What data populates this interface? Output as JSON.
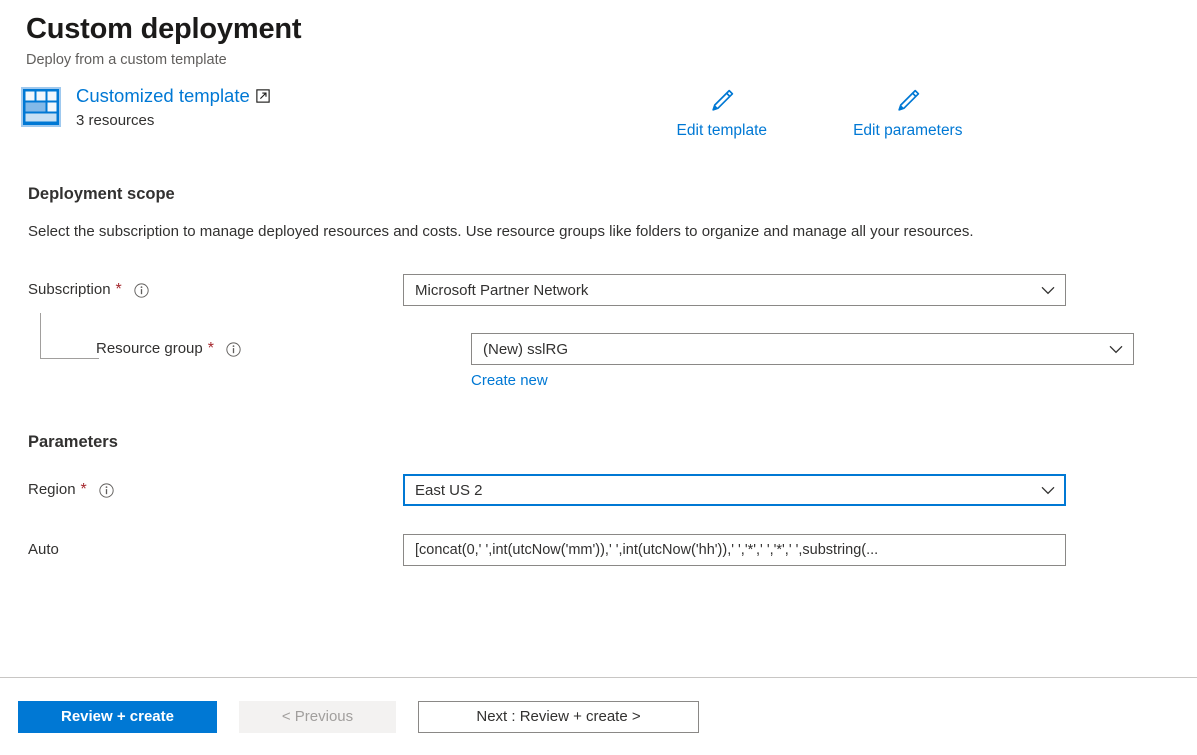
{
  "header": {
    "title": "Custom deployment",
    "subtitle": "Deploy from a custom template"
  },
  "template_summary": {
    "icon": "template-grid-icon",
    "link_label": "Customized template",
    "external_link_icon": "external-link-icon",
    "resource_count": "3 resources",
    "actions": [
      {
        "icon": "pencil-icon",
        "label": "Edit template"
      },
      {
        "icon": "pencil-icon",
        "label": "Edit parameters"
      }
    ]
  },
  "deployment_scope": {
    "heading": "Deployment scope",
    "description": "Select the subscription to manage deployed resources and costs. Use resource groups like folders to organize and manage all your resources.",
    "subscription": {
      "label": "Subscription",
      "required_marker": "*",
      "info_icon": "info-icon",
      "value": "Microsoft Partner Network"
    },
    "resource_group": {
      "label": "Resource group",
      "required_marker": "*",
      "info_icon": "info-icon",
      "value": "(New) sslRG",
      "create_new_label": "Create new"
    }
  },
  "parameters": {
    "heading": "Parameters",
    "region": {
      "label": "Region",
      "required_marker": "*",
      "info_icon": "info-icon",
      "value": "East US 2"
    },
    "auto": {
      "label": "Auto",
      "value": "[concat(0,' ',int(utcNow('mm')),' ',int(utcNow('hh')),' ','*',' ','*',' ',substring(..."
    }
  },
  "footer": {
    "review_create_label": "Review + create",
    "previous_label": "< Previous",
    "next_label": "Next : Review + create >"
  },
  "colors": {
    "accent": "#0078d4",
    "required": "#a4262c",
    "border": "#8a8886",
    "disabled_bg": "#f3f2f1"
  }
}
